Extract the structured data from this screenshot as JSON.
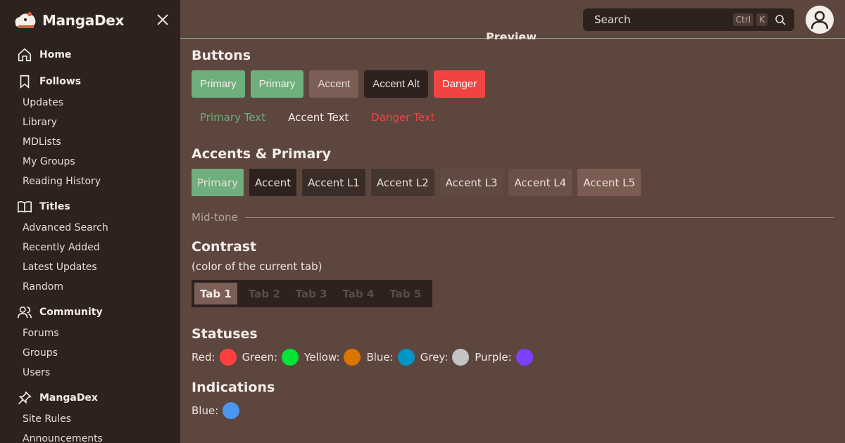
{
  "sidebar": {
    "brand": "MangaDex",
    "sections": [
      {
        "label": "Home",
        "icon": "home-icon",
        "items": []
      },
      {
        "label": "Follows",
        "icon": "bookmark-icon",
        "items": [
          "Updates",
          "Library",
          "MDLists",
          "My Groups",
          "Reading History"
        ]
      },
      {
        "label": "Titles",
        "icon": "book-icon",
        "items": [
          "Advanced Search",
          "Recently Added",
          "Latest Updates",
          "Random"
        ]
      },
      {
        "label": "Community",
        "icon": "users-icon",
        "items": [
          "Forums",
          "Groups",
          "Users"
        ]
      },
      {
        "label": "MangaDex",
        "icon": "pin-icon",
        "items": [
          "Site Rules",
          "Announcements"
        ]
      }
    ]
  },
  "topbar": {
    "search_placeholder": "Search",
    "kbd_ctrl": "Ctrl",
    "kbd_k": "K",
    "peek_title": "Preview"
  },
  "buttons": {
    "heading": "Buttons",
    "items": [
      "Primary",
      "Primary",
      "Accent",
      "Accent Alt",
      "Danger"
    ],
    "text_items": [
      "Primary Text",
      "Accent Text",
      "Danger Text"
    ]
  },
  "accents": {
    "heading": "Accents & Primary",
    "items": [
      "Primary",
      "Accent",
      "Accent L1",
      "Accent L2",
      "Accent L3",
      "Accent L4",
      "Accent L5"
    ]
  },
  "midtone": {
    "label": "Mid-tone"
  },
  "contrast": {
    "heading": "Contrast",
    "subtitle": "(color of the current tab)",
    "tabs": [
      "Tab 1",
      "Tab 2",
      "Tab 3",
      "Tab 4",
      "Tab 5"
    ]
  },
  "statuses": {
    "heading": "Statuses",
    "items": [
      {
        "label": "Red:",
        "color": "#ff4040"
      },
      {
        "label": "Green:",
        "color": "#00e535"
      },
      {
        "label": "Yellow:",
        "color": "#da7500"
      },
      {
        "label": "Blue:",
        "color": "#0095c8"
      },
      {
        "label": "Grey:",
        "color": "#c4c4c4"
      },
      {
        "label": "Purple:",
        "color": "#7d40ff"
      }
    ]
  },
  "indications": {
    "heading": "Indications",
    "items": [
      {
        "label": "Blue:",
        "color": "#4a96f0"
      }
    ]
  }
}
